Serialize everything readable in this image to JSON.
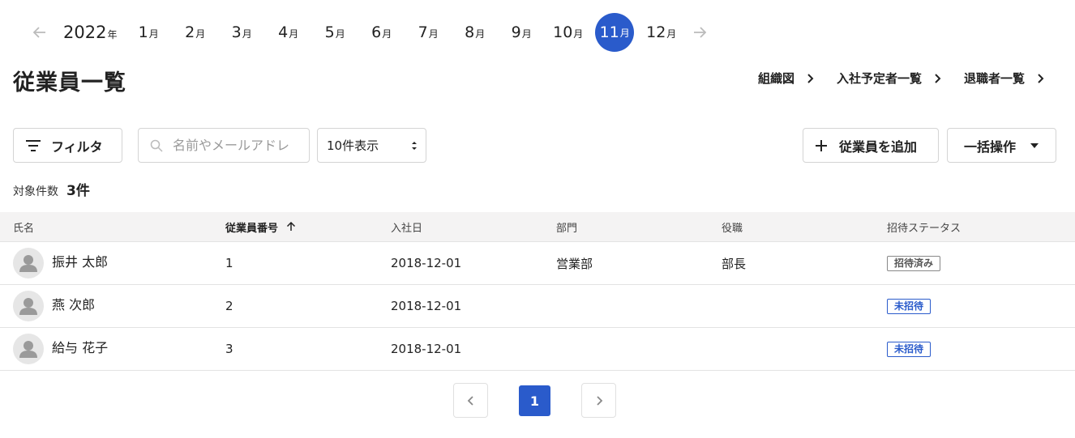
{
  "month_nav": {
    "year": "2022",
    "year_suffix": "年",
    "month_suffix": "月",
    "months": [
      "1",
      "2",
      "3",
      "4",
      "5",
      "6",
      "7",
      "8",
      "9",
      "10",
      "11",
      "12"
    ],
    "active_month": "11"
  },
  "header": {
    "title": "従業員一覧",
    "links": [
      "組織図",
      "入社予定者一覧",
      "退職者一覧"
    ]
  },
  "toolbar": {
    "filter_label": "フィルタ",
    "search_placeholder": "名前やメールアドレ",
    "per_page": "10件表示",
    "add_label": "従業員を追加",
    "bulk_label": "一括操作"
  },
  "count": {
    "label": "対象件数",
    "value": "3件"
  },
  "table": {
    "columns": [
      "氏名",
      "従業員番号",
      "入社日",
      "部門",
      "役職",
      "招待ステータス"
    ],
    "rows": [
      {
        "name": "振井 太郎",
        "number": "1",
        "date": "2018-12-01",
        "dept": "営業部",
        "role": "部長",
        "status": "招待済み"
      },
      {
        "name": "燕 次郎",
        "number": "2",
        "date": "2018-12-01",
        "dept": "",
        "role": "",
        "status": "未招待"
      },
      {
        "name": "給与 花子",
        "number": "3",
        "date": "2018-12-01",
        "dept": "",
        "role": "",
        "status": "未招待"
      }
    ]
  },
  "pagination": {
    "current": "1"
  },
  "colors": {
    "accent": "#2a5bcb",
    "header_bg": "#f4f3f3"
  },
  "icons": {
    "prev_year": "arrow-left-icon",
    "next_year": "arrow-right-icon",
    "filter": "filter-icon",
    "search": "search-icon",
    "add": "plus-icon",
    "bulk": "caret-down-icon",
    "sort": "arrow-up-icon",
    "avatar": "user-icon"
  }
}
